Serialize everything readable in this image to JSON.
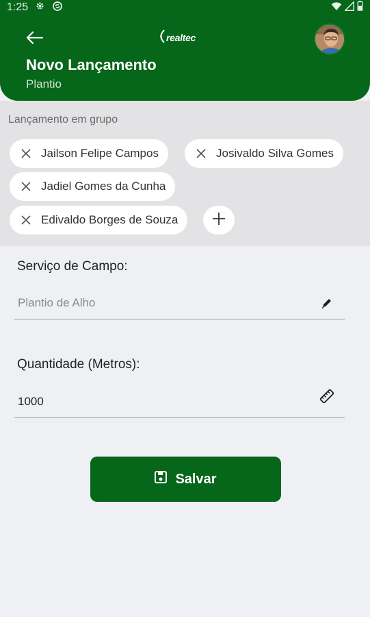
{
  "status_bar": {
    "time": "1:25"
  },
  "app_bar": {
    "title": "Novo Lançamento",
    "subtitle": "Plantio",
    "logo_text": "realtec"
  },
  "group": {
    "label": "Lançamento em grupo",
    "members": [
      "Jailson Felipe Campos",
      "Josivaldo Silva Gomes",
      "Jadiel Gomes da Cunha",
      "Edivaldo Borges de Souza"
    ]
  },
  "form": {
    "service": {
      "label": "Serviço de Campo:",
      "value": "Plantio de Alho"
    },
    "quantity": {
      "label": "Quantidade (Metros):",
      "value": "1000"
    }
  },
  "actions": {
    "save_label": "Salvar"
  },
  "colors": {
    "primary": "#06661a",
    "background": "#eef0f4",
    "group_bg": "#e3e3e6"
  },
  "icons": {
    "back": "arrow-left-icon",
    "remove": "close-icon",
    "add": "plus-icon",
    "edit": "pencil-icon",
    "measure": "ruler-icon",
    "save": "floppy-disk-icon"
  }
}
